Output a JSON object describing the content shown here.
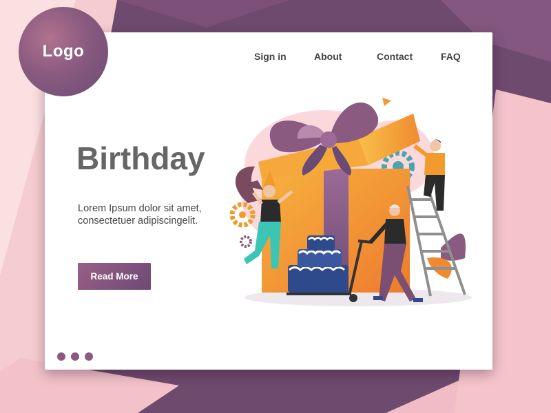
{
  "brand": {
    "logo_text": "Logo"
  },
  "nav": {
    "items": [
      {
        "label": "Sign in"
      },
      {
        "label": "About"
      },
      {
        "label": "Contact"
      },
      {
        "label": "FAQ"
      }
    ]
  },
  "hero": {
    "title": "Birthday",
    "text_lines": [
      "Lorem Ipsum dolor sit amet,",
      "consectetuer adipiscingelit."
    ],
    "button_label": "Read More"
  },
  "pagination": {
    "dot_count": 3
  },
  "colors": {
    "background": "#6e4a6e",
    "card": "#ffffff",
    "accent": "#8a5a80",
    "gift_orange": "#f39a2e",
    "ribbon": "#8a5a80"
  },
  "illustration": {
    "subject": "gift-box-party-scene"
  }
}
